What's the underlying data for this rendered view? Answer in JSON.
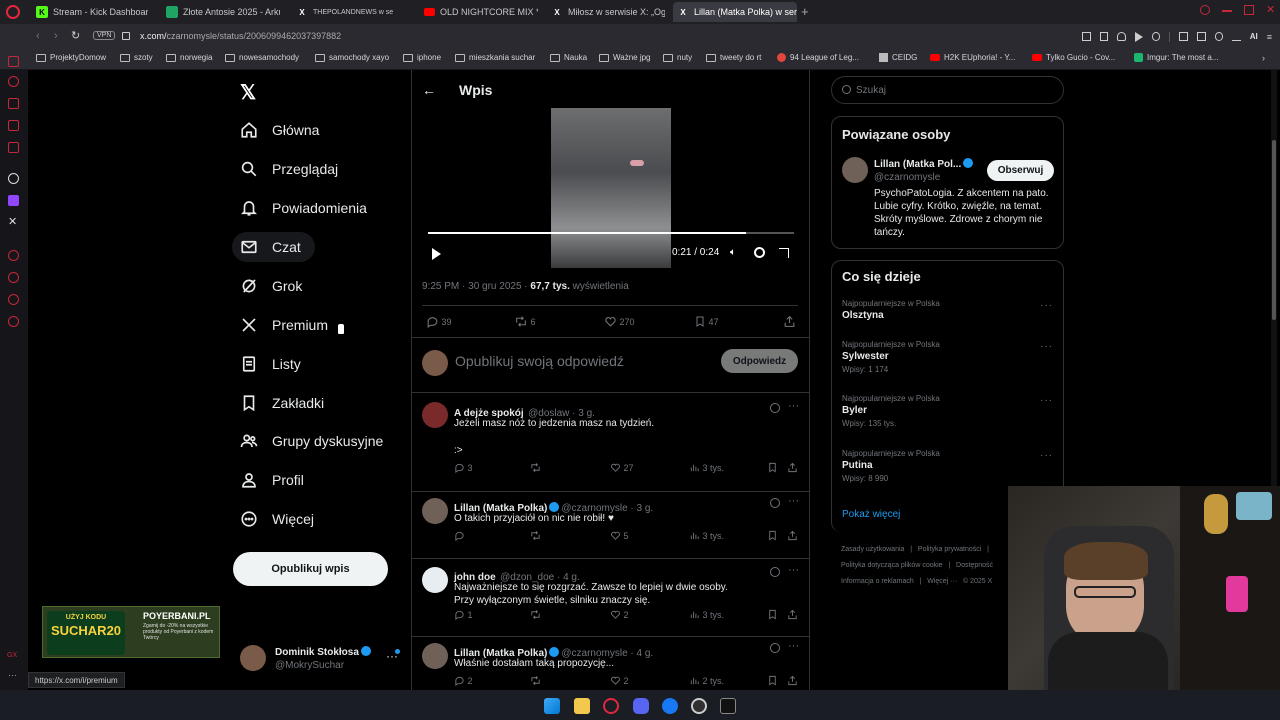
{
  "browser": {
    "tabs": [
      {
        "label": "Stream - Kick Dashboard",
        "fav": "K",
        "color": "#53fc18"
      },
      {
        "label": "Złote Antosie 2025 - Arku",
        "fav": "",
        "color": "#1fa463"
      },
      {
        "label": "THEPOLANDNEWS w se",
        "fav": "X",
        "color": "#ffffff"
      },
      {
        "label": "OLD NIGHTCORE MIX *20",
        "fav": "",
        "color": "#ff0000"
      },
      {
        "label": "Miłosz w serwisie X: „Ogi",
        "fav": "X",
        "color": "#ffffff"
      },
      {
        "label": "Lillan (Matka Polka) w serw",
        "fav": "X",
        "color": "#ffffff"
      }
    ],
    "url_host": "x.com/",
    "url_path": "czarnomysle/status/2006099462037397882",
    "vpn": "VPN",
    "ai_label": "AI",
    "bookmarks": [
      "ProjektyDomow",
      "szoty",
      "norwegia",
      "nowesamochody",
      "samochody xayo",
      "iphone",
      "mieszkania suchar",
      "Nauka",
      "Ważne jpg",
      "nuty",
      "tweety do rt",
      "94 League of Leg...",
      "CEIDG",
      "H2K EUphoria! - Y...",
      "Tylko Gucio - Cov...",
      "Imgur: The most a..."
    ]
  },
  "nav": {
    "items": [
      "Główna",
      "Przeglądaj",
      "Powiadomienia",
      "Czat",
      "Grok",
      "Premium",
      "Listy",
      "Zakładki",
      "Grupy dyskusyjne",
      "Profil",
      "Więcej"
    ],
    "post_button": "Opublikuj wpis",
    "user_name": "Dominik Stokłosa",
    "user_handle": "@MokrySuchar",
    "status_url": "https://x.com/i/premium"
  },
  "ad": {
    "line1": "UŻYJ KODU",
    "code": "SUCHAR20",
    "site": "POYERBANI.PL",
    "desc": "Zgarnij do -20% na wszystkie produkty od Poyerbani z kodem Twórcy"
  },
  "post": {
    "header": "Wpis",
    "video_time": "0:21 / 0:24",
    "video_progress": 0.87,
    "timestamp": "9:25 PM · 30 gru 2025 · ",
    "views": "67,7 tys.",
    "views_label": " wyświetlenia",
    "replies": "39",
    "reposts": "6",
    "likes": "270",
    "bookmarks": "47",
    "reply_placeholder": "Opublikuj swoją odpowiedź",
    "reply_button": "Odpowiedz"
  },
  "replies": [
    {
      "name": "A dejże spokój",
      "handle": "@doslaw · 3 g.",
      "verified": false,
      "text": "Jeżeli masz nóż to jedzenia masz na tydzień.",
      "text2": ":>",
      "replies": "3",
      "reposts": "",
      "likes": "27",
      "views": "3 tys."
    },
    {
      "name": "Lillan (Matka Polka)",
      "handle": "@czarnomysle · 3 g.",
      "verified": true,
      "text": "O takich przyjaciół on nic nie robił! ♥",
      "text2": "",
      "replies": "",
      "reposts": "",
      "likes": "5",
      "views": "3 tys."
    },
    {
      "name": "john doe",
      "handle": "@dzon_doe · 4 g.",
      "verified": false,
      "text": "Najważniejsze to się rozgrzać. Zawsze to lepiej w dwie osoby.",
      "text2": "Przy wyłączonym świetle, silniku znaczy się.",
      "replies": "1",
      "reposts": "",
      "likes": "2",
      "views": "3 tys."
    },
    {
      "name": "Lillan (Matka Polka)",
      "handle": "@czarnomysle · 4 g.",
      "verified": true,
      "text": "Właśnie dostałam taką propozycję...",
      "text2": "",
      "replies": "2",
      "reposts": "",
      "likes": "2",
      "views": "2 tys."
    }
  ],
  "sidebar": {
    "search_placeholder": "Szukaj",
    "related_title": "Powiązane osoby",
    "related_name": "Lillan (Matka Pol...",
    "related_handle": "@czarnomysle",
    "follow_button": "Obserwuj",
    "related_bio": "PsychoPatoLogia. Z akcentem na pato. Lubie cyfry. Krótko, zwięźle, na temat. Skróty myślowe. Zdrowe z chorym nie tańczy.",
    "trends_title": "Co się dzieje",
    "trends": [
      {
        "label": "Najpopularniejsze w Polska",
        "title": "Olsztyna",
        "count": ""
      },
      {
        "label": "Najpopularniejsze w Polska",
        "title": "Sylwester",
        "count": "Wpisy: 1 174"
      },
      {
        "label": "Najpopularniejsze w Polska",
        "title": "Byler",
        "count": "Wpisy: 135 tys."
      },
      {
        "label": "Najpopularniejsze w Polska",
        "title": "Putina",
        "count": "Wpisy: 8 990"
      }
    ],
    "show_more": "Pokaż więcej",
    "footer1": "Zasady użytkowania   |   Polityka prywatności   |",
    "footer2": "Polityka dotycząca plików cookie   |   Dostępność",
    "footer3": "Informacja o reklamach   |   Więcej ···   © 2025 X"
  }
}
